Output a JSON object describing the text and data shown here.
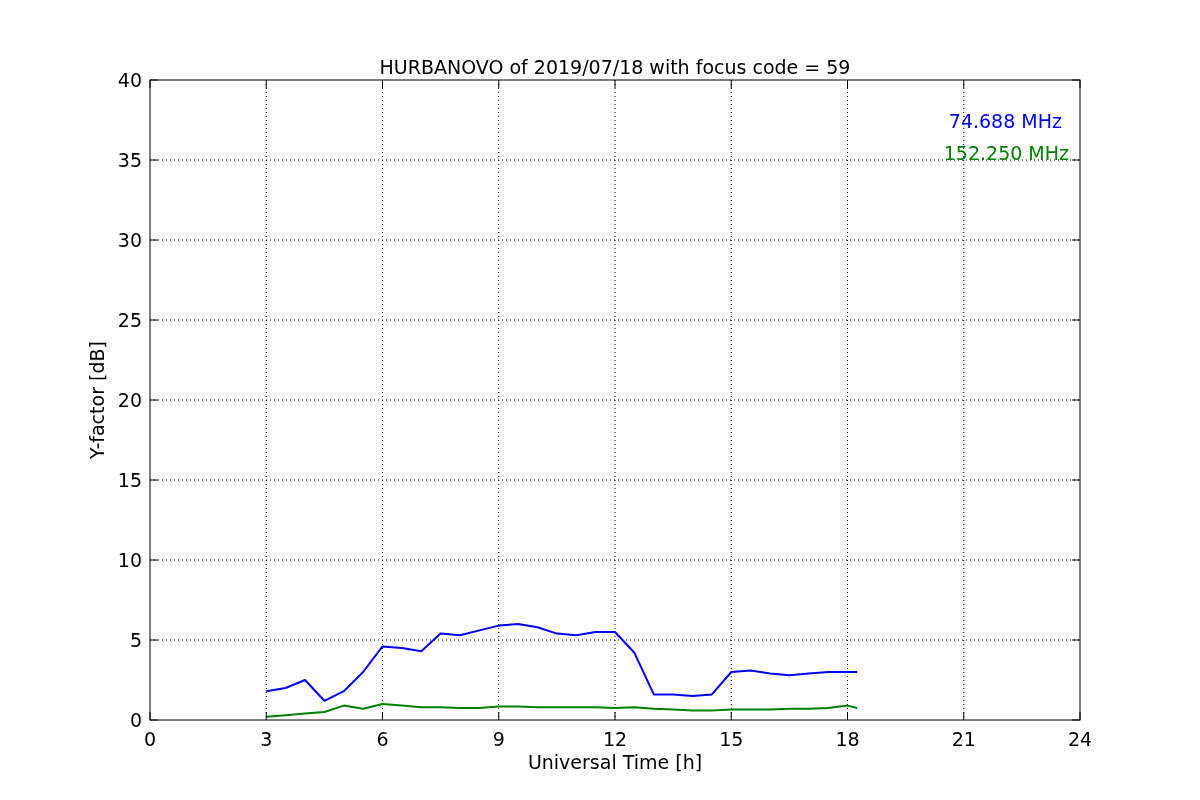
{
  "chart_data": {
    "type": "line",
    "title": "HURBANOVO of 2019/07/18 with focus code = 59",
    "xlabel": "Universal Time [h]",
    "ylabel": "Y-factor [dB]",
    "x": [
      3,
      3.5,
      4,
      4.5,
      5,
      5.5,
      6,
      6.5,
      7,
      7.5,
      8,
      8.5,
      9,
      9.5,
      10,
      10.5,
      11,
      11.5,
      12,
      12.5,
      13,
      13.5,
      14,
      14.5,
      15,
      15.5,
      16,
      16.5,
      17,
      17.5,
      18,
      18.25
    ],
    "series": [
      {
        "name": "74.688 MHz",
        "color": "#0000ff",
        "values": [
          1.8,
          2.0,
          2.5,
          1.2,
          1.8,
          3.0,
          4.6,
          4.5,
          4.3,
          5.4,
          5.3,
          5.6,
          5.9,
          6.0,
          5.8,
          5.4,
          5.3,
          5.5,
          5.5,
          4.2,
          1.6,
          1.6,
          1.5,
          1.6,
          3.0,
          3.1,
          2.9,
          2.8,
          2.9,
          3.0,
          3.0,
          3.0
        ]
      },
      {
        "name": "152.250 MHz",
        "color": "#008000",
        "values": [
          0.2,
          0.3,
          0.4,
          0.5,
          0.9,
          0.7,
          1.0,
          0.9,
          0.8,
          0.8,
          0.75,
          0.75,
          0.85,
          0.85,
          0.8,
          0.8,
          0.8,
          0.8,
          0.75,
          0.8,
          0.7,
          0.65,
          0.6,
          0.6,
          0.65,
          0.65,
          0.65,
          0.7,
          0.7,
          0.75,
          0.9,
          0.75
        ]
      }
    ],
    "grid": true,
    "xlim": [
      0,
      24
    ],
    "ylim": [
      0,
      40
    ],
    "xticks": [
      0,
      3,
      6,
      9,
      12,
      15,
      18,
      21,
      24
    ],
    "yticks": [
      0,
      5,
      10,
      15,
      20,
      25,
      30,
      35,
      40
    ]
  }
}
